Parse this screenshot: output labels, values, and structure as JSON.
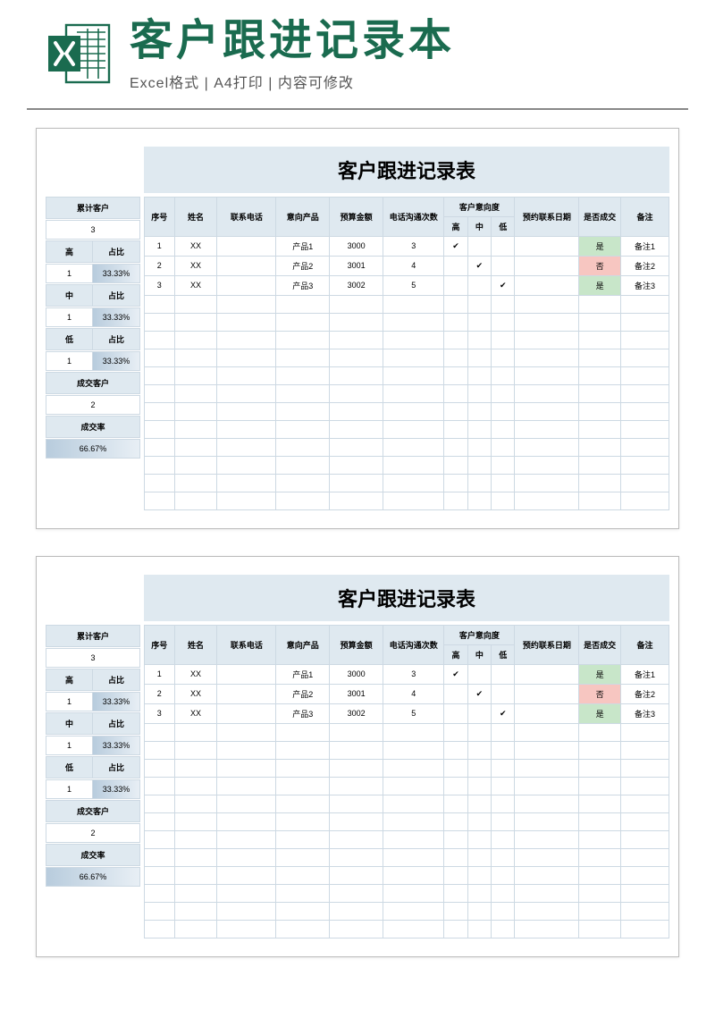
{
  "header": {
    "title": "客户跟进记录本",
    "subtitle_parts": [
      "Excel格式",
      "A4打印",
      "内容可修改"
    ],
    "separator": " | "
  },
  "sheet": {
    "title": "客户跟进记录表",
    "summary": {
      "total_label": "累计客户",
      "total_value": "3",
      "ratio_label": "占比",
      "high_label": "高",
      "high_count": "1",
      "high_ratio": "33.33%",
      "mid_label": "中",
      "mid_count": "1",
      "mid_ratio": "33.33%",
      "low_label": "低",
      "low_count": "1",
      "low_ratio": "33.33%",
      "deal_label": "成交客户",
      "deal_value": "2",
      "rate_label": "成交率",
      "rate_value": "66.67%"
    },
    "columns": {
      "seq": "序号",
      "name": "姓名",
      "phone": "联系电话",
      "product": "意向产品",
      "budget": "预算金额",
      "calls": "电话沟通次数",
      "intent": "客户意向度",
      "intent_high": "高",
      "intent_mid": "中",
      "intent_low": "低",
      "date": "预约联系日期",
      "deal": "是否成交",
      "note": "备注"
    },
    "rows": [
      {
        "seq": "1",
        "name": "XX",
        "phone": "",
        "product": "产品1",
        "budget": "3000",
        "calls": "3",
        "high": "✔",
        "mid": "",
        "low": "",
        "date": "",
        "deal": "是",
        "deal_class": "yes",
        "note": "备注1"
      },
      {
        "seq": "2",
        "name": "XX",
        "phone": "",
        "product": "产品2",
        "budget": "3001",
        "calls": "4",
        "high": "",
        "mid": "✔",
        "low": "",
        "date": "",
        "deal": "否",
        "deal_class": "no",
        "note": "备注2"
      },
      {
        "seq": "3",
        "name": "XX",
        "phone": "",
        "product": "产品3",
        "budget": "3002",
        "calls": "5",
        "high": "",
        "mid": "",
        "low": "✔",
        "date": "",
        "deal": "是",
        "deal_class": "yes",
        "note": "备注3"
      }
    ],
    "empty_rows": 12
  }
}
